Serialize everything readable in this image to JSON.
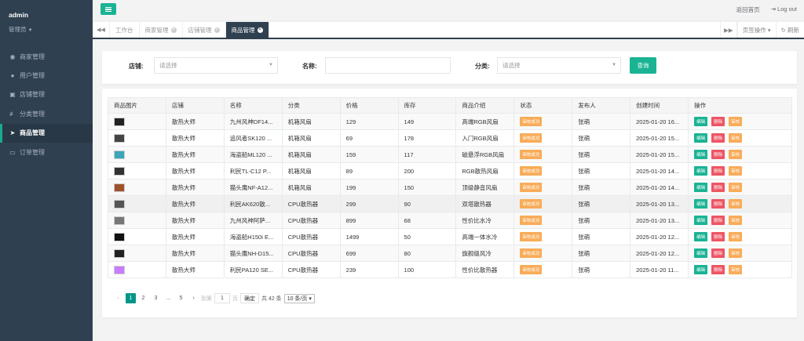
{
  "sidebar": {
    "user": "admin",
    "role": "管理员",
    "items": [
      {
        "label": "商家管理",
        "icon": "user-circle-icon"
      },
      {
        "label": "用户管理",
        "icon": "user-icon"
      },
      {
        "label": "店铺管理",
        "icon": "store-icon"
      },
      {
        "label": "分类管理",
        "icon": "tags-icon"
      },
      {
        "label": "商品管理",
        "icon": "send-icon",
        "active": true
      },
      {
        "label": "订单管理",
        "icon": "card-icon"
      }
    ]
  },
  "header": {
    "home": "返回首页",
    "logout": "Log out"
  },
  "tabs": {
    "items": [
      {
        "label": "工作台",
        "closable": false
      },
      {
        "label": "商家管理",
        "closable": true
      },
      {
        "label": "店铺管理",
        "closable": true
      },
      {
        "label": "商品管理",
        "closable": true,
        "active": true
      }
    ],
    "ops": "页签操作",
    "refresh": "刷新"
  },
  "search": {
    "store_label": "店铺:",
    "store_placeholder": "请选择",
    "name_label": "名称:",
    "name_value": "",
    "category_label": "分类:",
    "category_placeholder": "请选择",
    "query_button": "查询"
  },
  "table": {
    "headers": [
      "商品图片",
      "店铺",
      "名称",
      "分类",
      "价格",
      "库存",
      "商品介绍",
      "状态",
      "发布人",
      "创建时间",
      "操作"
    ],
    "rows": [
      {
        "store": "散热大师",
        "name": "九州风神DF14...",
        "category": "机箱风扇",
        "price": "129",
        "stock": "149",
        "desc": "高端RGB风扇",
        "status": "审核成功",
        "publisher": "张萌",
        "created": "2025-01-20 16...",
        "thumb": "#222"
      },
      {
        "store": "散热大师",
        "name": "追风者SK120 ...",
        "category": "机箱风扇",
        "price": "69",
        "stock": "178",
        "desc": "入门RGB风扇",
        "status": "审核成功",
        "publisher": "张萌",
        "created": "2025-01-20 15...",
        "thumb": "#444"
      },
      {
        "store": "散热大师",
        "name": "海盗船ML120 ...",
        "category": "机箱风扇",
        "price": "159",
        "stock": "117",
        "desc": "磁悬浮RGB风扇",
        "status": "审核成功",
        "publisher": "张萌",
        "created": "2025-01-20 15...",
        "thumb": "#3aa6b9"
      },
      {
        "store": "散热大师",
        "name": "利民TL-C12 P...",
        "category": "机箱风扇",
        "price": "89",
        "stock": "200",
        "desc": "RGB散热风扇",
        "status": "审核成功",
        "publisher": "张萌",
        "created": "2025-01-20 14...",
        "thumb": "#333"
      },
      {
        "store": "散热大师",
        "name": "猫头鹰NF-A12...",
        "category": "机箱风扇",
        "price": "199",
        "stock": "150",
        "desc": "顶级静音风扇",
        "status": "审核成功",
        "publisher": "张萌",
        "created": "2025-01-20 14...",
        "thumb": "#a0522d"
      },
      {
        "store": "散热大师",
        "name": "利民AK620散...",
        "category": "CPU散热器",
        "price": "299",
        "stock": "90",
        "desc": "双塔散热器",
        "status": "审核成功",
        "publisher": "张萌",
        "created": "2025-01-20 13...",
        "thumb": "#555"
      },
      {
        "store": "散热大师",
        "name": "九州风神阿萨...",
        "category": "CPU散热器",
        "price": "899",
        "stock": "68",
        "desc": "性价比水冷",
        "status": "审核成功",
        "publisher": "张萌",
        "created": "2025-01-20 13...",
        "thumb": "#777"
      },
      {
        "store": "散热大师",
        "name": "海盗船H150i E...",
        "category": "CPU散热器",
        "price": "1499",
        "stock": "50",
        "desc": "高端一体水冷",
        "status": "审核成功",
        "publisher": "张萌",
        "created": "2025-01-20 12...",
        "thumb": "#111"
      },
      {
        "store": "散热大师",
        "name": "猫头鹰NH-D15...",
        "category": "CPU散热器",
        "price": "699",
        "stock": "80",
        "desc": "旗舰级风冷",
        "status": "审核成功",
        "publisher": "张萌",
        "created": "2025-01-20 12...",
        "thumb": "#222"
      },
      {
        "store": "散热大师",
        "name": "利民PA120 SE...",
        "category": "CPU散热器",
        "price": "239",
        "stock": "100",
        "desc": "性价比散热器",
        "status": "审核成功",
        "publisher": "张萌",
        "created": "2025-01-20 11...",
        "thumb": "#c77dff"
      }
    ],
    "actions": {
      "edit": "编辑",
      "delete": "删除",
      "audit": "审核"
    }
  },
  "pager": {
    "pages": [
      "1",
      "2",
      "3",
      "...",
      "5"
    ],
    "current": "1",
    "goto_label": "到第",
    "goto_value": "1",
    "page_unit": "页",
    "confirm": "确定",
    "total": "共 42 条",
    "size": "10 条/页"
  }
}
